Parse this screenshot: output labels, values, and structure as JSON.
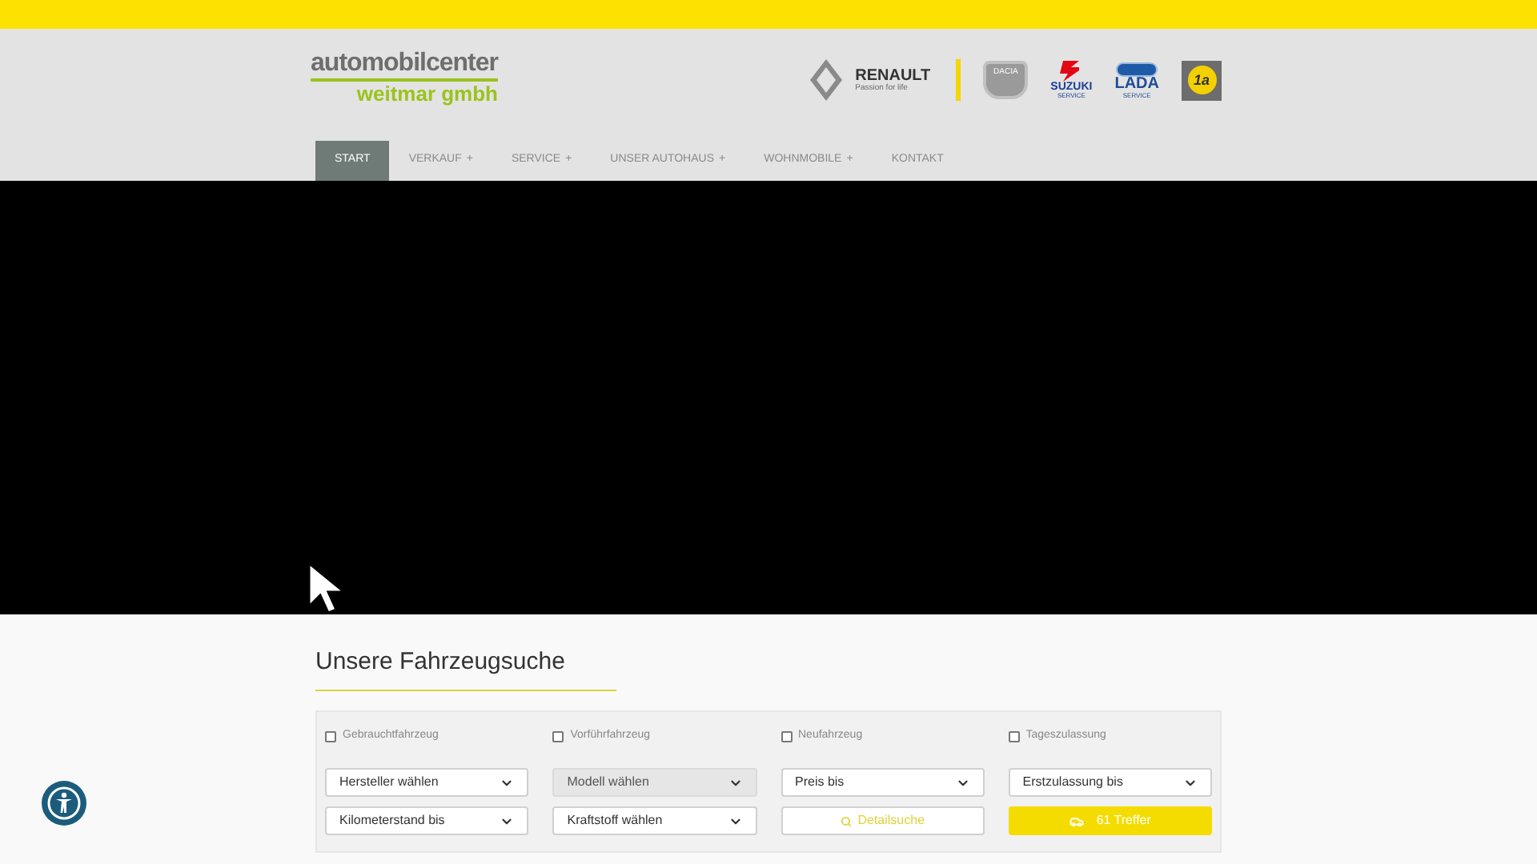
{
  "logo": {
    "line_1": "automobilcenter",
    "line_2": "weitmar gmbh"
  },
  "brands": [
    {
      "kind": "renault",
      "name": "RENAULT",
      "tagline": "Passion for life"
    },
    {
      "kind": "dacia",
      "name": "DACIA"
    },
    {
      "kind": "suzuki",
      "name": "SUZUKI",
      "tagline": "SERVICE"
    },
    {
      "kind": "lada",
      "name": "LADA",
      "tagline": "SERVICE"
    },
    {
      "kind": "badge",
      "name": "1a"
    }
  ],
  "nav": [
    {
      "label": "START",
      "selected": true,
      "submenu": false
    },
    {
      "label": "VERKAUF",
      "selected": false,
      "submenu": true
    },
    {
      "label": "SERVICE",
      "selected": false,
      "submenu": true
    },
    {
      "label": "UNSER AUTOHAUS",
      "selected": false,
      "submenu": true
    },
    {
      "label": "WOHNMOBILE",
      "selected": false,
      "submenu": true
    },
    {
      "label": "KONTAKT",
      "selected": false,
      "submenu": false
    }
  ],
  "plus_sign": "+",
  "search": {
    "title": "Unsere Fahrzeugsuche",
    "checkboxes": [
      {
        "label": "Gebrauchtfahrzeug",
        "checked": false
      },
      {
        "label": "Vorführfahrzeug",
        "checked": false
      },
      {
        "label": "Neufahrzeug",
        "checked": false
      },
      {
        "label": "Tageszulassung",
        "checked": false
      }
    ],
    "controls": [
      {
        "kind": "select",
        "value": "Hersteller wählen",
        "disabled": false
      },
      {
        "kind": "select",
        "value": "Modell wählen",
        "disabled": true
      },
      {
        "kind": "select",
        "value": "Preis bis",
        "disabled": false
      },
      {
        "kind": "select",
        "value": "Erstzulassung bis",
        "disabled": false
      },
      {
        "kind": "select",
        "value": "Kilometerstand bis",
        "disabled": false
      },
      {
        "kind": "select",
        "value": "Kraftstoff wählen",
        "disabled": false
      },
      {
        "kind": "link",
        "value": "Detailsuche",
        "disabled": false
      },
      {
        "kind": "submit",
        "value": "61 Treffer",
        "disabled": false
      }
    ]
  }
}
